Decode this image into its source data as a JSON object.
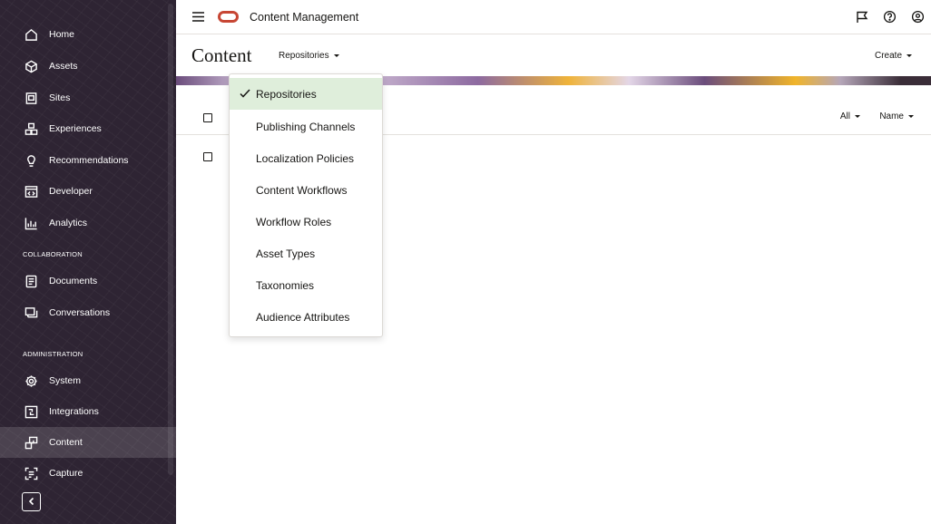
{
  "app": {
    "title": "Content Management"
  },
  "sidebar": {
    "items": [
      {
        "label": "Home",
        "icon": "home-icon"
      },
      {
        "label": "Assets",
        "icon": "assets-icon"
      },
      {
        "label": "Sites",
        "icon": "sites-icon"
      },
      {
        "label": "Experiences",
        "icon": "experiences-icon"
      },
      {
        "label": "Recommendations",
        "icon": "recommendations-icon"
      },
      {
        "label": "Developer",
        "icon": "developer-icon"
      },
      {
        "label": "Analytics",
        "icon": "analytics-icon"
      }
    ],
    "collaboration": {
      "label": "COLLABORATION",
      "items": [
        {
          "label": "Documents",
          "icon": "documents-icon"
        },
        {
          "label": "Conversations",
          "icon": "conversations-icon"
        }
      ]
    },
    "administration": {
      "label": "ADMINISTRATION",
      "items": [
        {
          "label": "System",
          "icon": "system-gear-icon"
        },
        {
          "label": "Integrations",
          "icon": "integrations-icon"
        },
        {
          "label": "Content",
          "icon": "content-icon",
          "active": true
        },
        {
          "label": "Capture",
          "icon": "capture-icon"
        }
      ]
    }
  },
  "header": {
    "title": "Content",
    "repo_dropdown": "Repositories",
    "create": "Create"
  },
  "list": {
    "filter_all": "All",
    "sort_name": "Name"
  },
  "dropdown": {
    "selected": "Repositories",
    "items": [
      "Repositories",
      "Publishing Channels",
      "Localization Policies",
      "Content Workflows",
      "Workflow Roles",
      "Asset Types",
      "Taxonomies",
      "Audience Attributes"
    ]
  },
  "colors": {
    "sidebar_bg": "#2e2433",
    "oracle_red": "#c74634",
    "selected_bg": "#dfeedb"
  }
}
